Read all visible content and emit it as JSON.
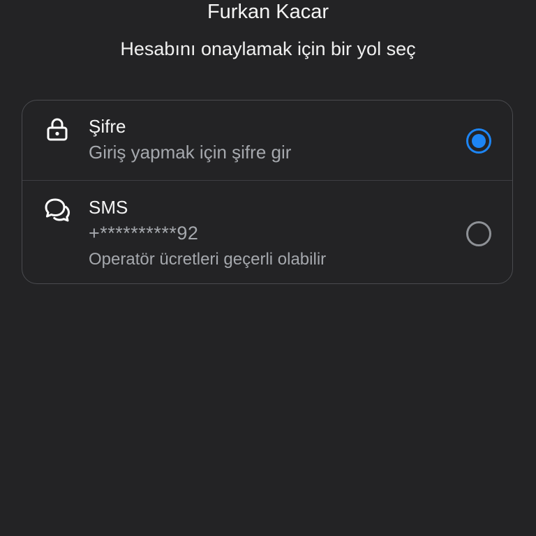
{
  "header": {
    "user_name": "Furkan Kacar",
    "subtitle": "Hesabını onaylamak için bir yol seç"
  },
  "options": [
    {
      "icon": "lock-icon",
      "title": "Şifre",
      "description": "Giriş yapmak için şifre gir",
      "selected": true
    },
    {
      "icon": "chat-bubbles-icon",
      "title": "SMS",
      "phone": "+**********92",
      "note": "Operatör ücretleri geçerli olabilir",
      "selected": false
    }
  ],
  "colors": {
    "background": "#232325",
    "accent": "#1d85f4",
    "border": "#4a4b4f",
    "secondary_text": "#a5a8ad"
  }
}
